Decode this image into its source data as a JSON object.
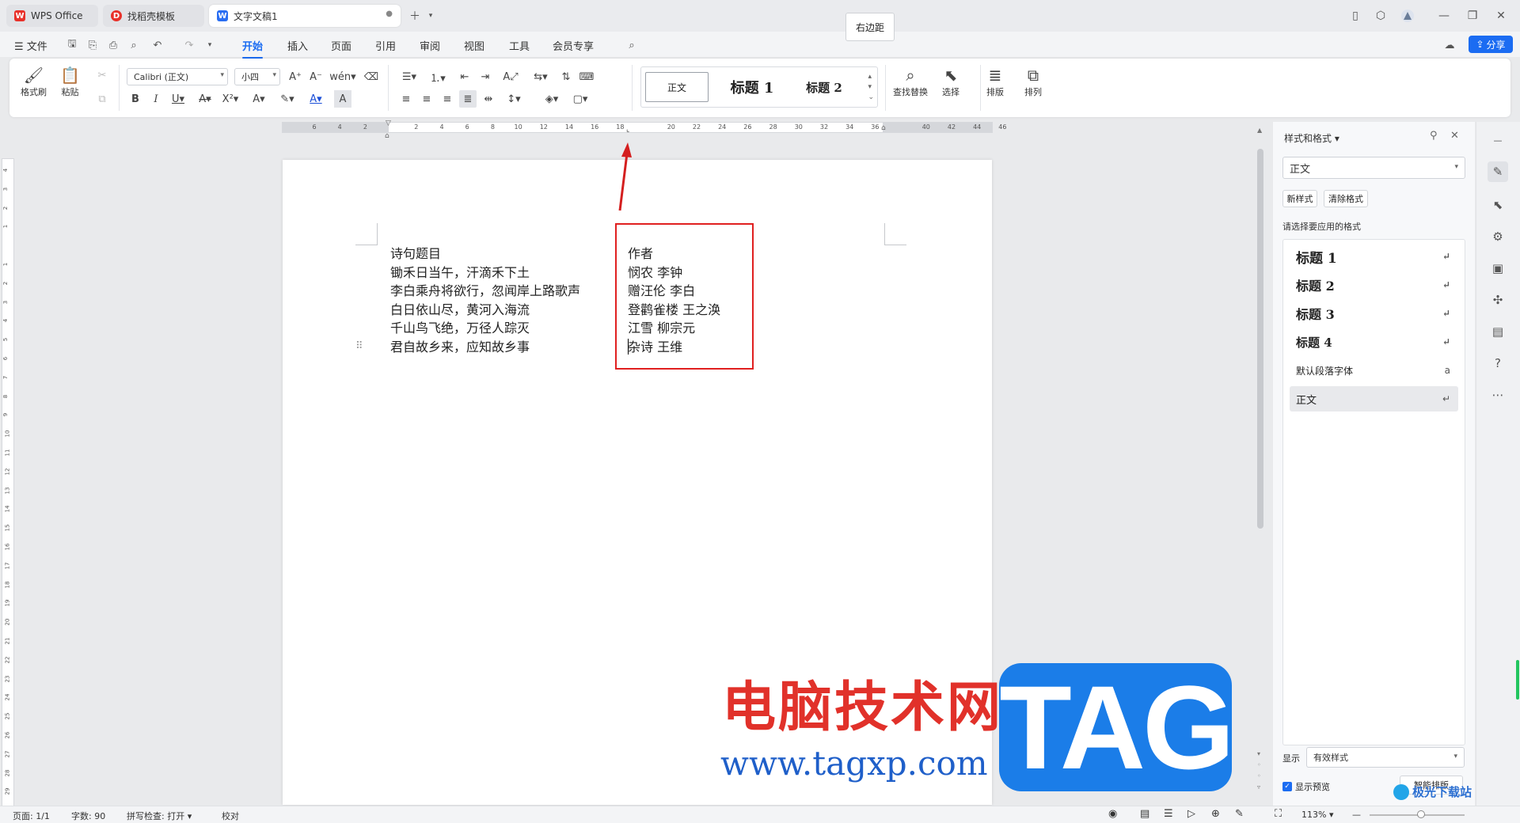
{
  "tabs": [
    {
      "label": "WPS Office",
      "icon": "wps-logo-icon"
    },
    {
      "label": "找稻壳模板",
      "icon": "docer-icon"
    },
    {
      "label": "文字文稿1",
      "icon": "writer-doc-icon"
    }
  ],
  "tooltip": "右边距",
  "menu": {
    "file": "文件",
    "items": [
      "开始",
      "插入",
      "页面",
      "引用",
      "审阅",
      "视图",
      "工具",
      "会员专享"
    ],
    "share": "分享"
  },
  "ribbon": {
    "format_painter": "格式刷",
    "paste": "粘贴",
    "font_name": "Calibri (正文)",
    "font_size": "小四",
    "styles": [
      "正文",
      "标题 1",
      "标题 2"
    ],
    "find_replace": "查找替换",
    "select": "选择",
    "layout": "排版",
    "arrange": "排列"
  },
  "ruler_labels": [
    "6",
    "4",
    "2",
    "",
    "2",
    "4",
    "6",
    "8",
    "10",
    "12",
    "14",
    "16",
    "18",
    "",
    "20",
    "22",
    "24",
    "26",
    "28",
    "30",
    "32",
    "34",
    "36",
    "",
    "40",
    "42",
    "44",
    "46"
  ],
  "vruler_labels": [
    "4",
    "3",
    "2",
    "1",
    "",
    "1",
    "2",
    "3",
    "4",
    "5",
    "6",
    "7",
    "8",
    "9",
    "10",
    "11",
    "12",
    "13",
    "14",
    "15",
    "16",
    "17",
    "18",
    "19",
    "20",
    "21",
    "22",
    "23",
    "24",
    "25",
    "26",
    "27",
    "28",
    "29"
  ],
  "document": {
    "col1": [
      "诗句题目",
      "锄禾日当午，汗滴禾下土",
      "李白乘舟将欲行，忽闻岸上路歌声",
      "白日依山尽，黄河入海流",
      "千山鸟飞绝，万径人踪灭",
      "君自故乡来，应知故乡事"
    ],
    "col2": [
      "作者",
      "悯农  李钟",
      "赠汪伦  李白",
      "登鹳雀楼  王之涣",
      "江雪  柳宗元",
      "杂诗  王维"
    ]
  },
  "panel": {
    "title": "样式和格式",
    "current_style": "正文",
    "new_style": "新样式",
    "clear_format": "清除格式",
    "apply_label": "请选择要应用的格式",
    "styles": [
      "标题 1",
      "标题 2",
      "标题 3",
      "标题 4",
      "默认段落字体",
      "正文"
    ],
    "show_label": "显示",
    "show_value": "有效样式",
    "preview_label": "显示预览",
    "smart_layout": "智能排版"
  },
  "status": {
    "page": "页面: 1/1",
    "words": "字数: 90",
    "spell": "拼写检查: 打开",
    "proof": "校对",
    "zoom": "113%"
  },
  "watermark": {
    "cn": "电脑技术网",
    "url": "www.tagxp.com",
    "tag": "TAG",
    "corner": "极光下载站"
  }
}
